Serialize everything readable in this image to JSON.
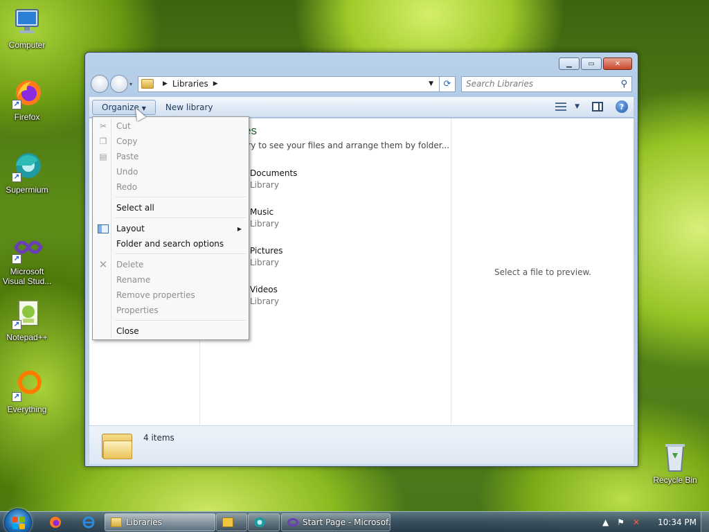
{
  "desktop": {
    "icons": [
      {
        "label": "Computer",
        "icon": "computer-icon"
      },
      {
        "label": "Firefox",
        "icon": "firefox-icon"
      },
      {
        "label": "Supermium",
        "icon": "supermium-icon"
      },
      {
        "label": "Microsoft Visual Stud...",
        "icon": "visual-studio-icon"
      },
      {
        "label": "Notepad++",
        "icon": "notepadpp-icon"
      },
      {
        "label": "Everything",
        "icon": "everything-icon"
      },
      {
        "label": "Recycle Bin",
        "icon": "recycle-bin-icon"
      }
    ]
  },
  "window": {
    "address": {
      "segment": "Libraries"
    },
    "search": {
      "placeholder": "Search Libraries"
    },
    "commandbar": {
      "organize_label": "Organize",
      "new_library_label": "New library"
    },
    "library": {
      "title_fragment": "es",
      "subtitle_fragment": "rary to see your files and arrange them by folder...",
      "items": [
        {
          "name": "Documents",
          "type": "Library"
        },
        {
          "name": "Music",
          "type": "Library"
        },
        {
          "name": "Pictures",
          "type": "Library"
        },
        {
          "name": "Videos",
          "type": "Library"
        }
      ]
    },
    "preview": {
      "text": "Select a file to preview."
    },
    "details": {
      "count": "4 items"
    }
  },
  "organize_menu": {
    "groups": [
      [
        {
          "label": "Cut",
          "enabled": false,
          "icon": "scissors-icon"
        },
        {
          "label": "Copy",
          "enabled": false,
          "icon": "copy-icon"
        },
        {
          "label": "Paste",
          "enabled": false,
          "icon": "paste-icon"
        },
        {
          "label": "Undo",
          "enabled": false
        },
        {
          "label": "Redo",
          "enabled": false
        }
      ],
      [
        {
          "label": "Select all",
          "enabled": true
        }
      ],
      [
        {
          "label": "Layout",
          "enabled": true,
          "icon": "layout-icon",
          "submenu": true
        },
        {
          "label": "Folder and search options",
          "enabled": true
        }
      ],
      [
        {
          "label": "Delete",
          "enabled": false,
          "icon": "delete-icon"
        },
        {
          "label": "Rename",
          "enabled": false
        },
        {
          "label": "Remove properties",
          "enabled": false
        },
        {
          "label": "Properties",
          "enabled": false
        }
      ],
      [
        {
          "label": "Close",
          "enabled": true
        }
      ]
    ]
  },
  "taskbar": {
    "tasks": [
      {
        "label": "Libraries",
        "active": true
      },
      {
        "label": "",
        "active": false
      },
      {
        "label": "Start Page - Microsof...",
        "active": false
      }
    ],
    "clock": "10:34 PM"
  }
}
